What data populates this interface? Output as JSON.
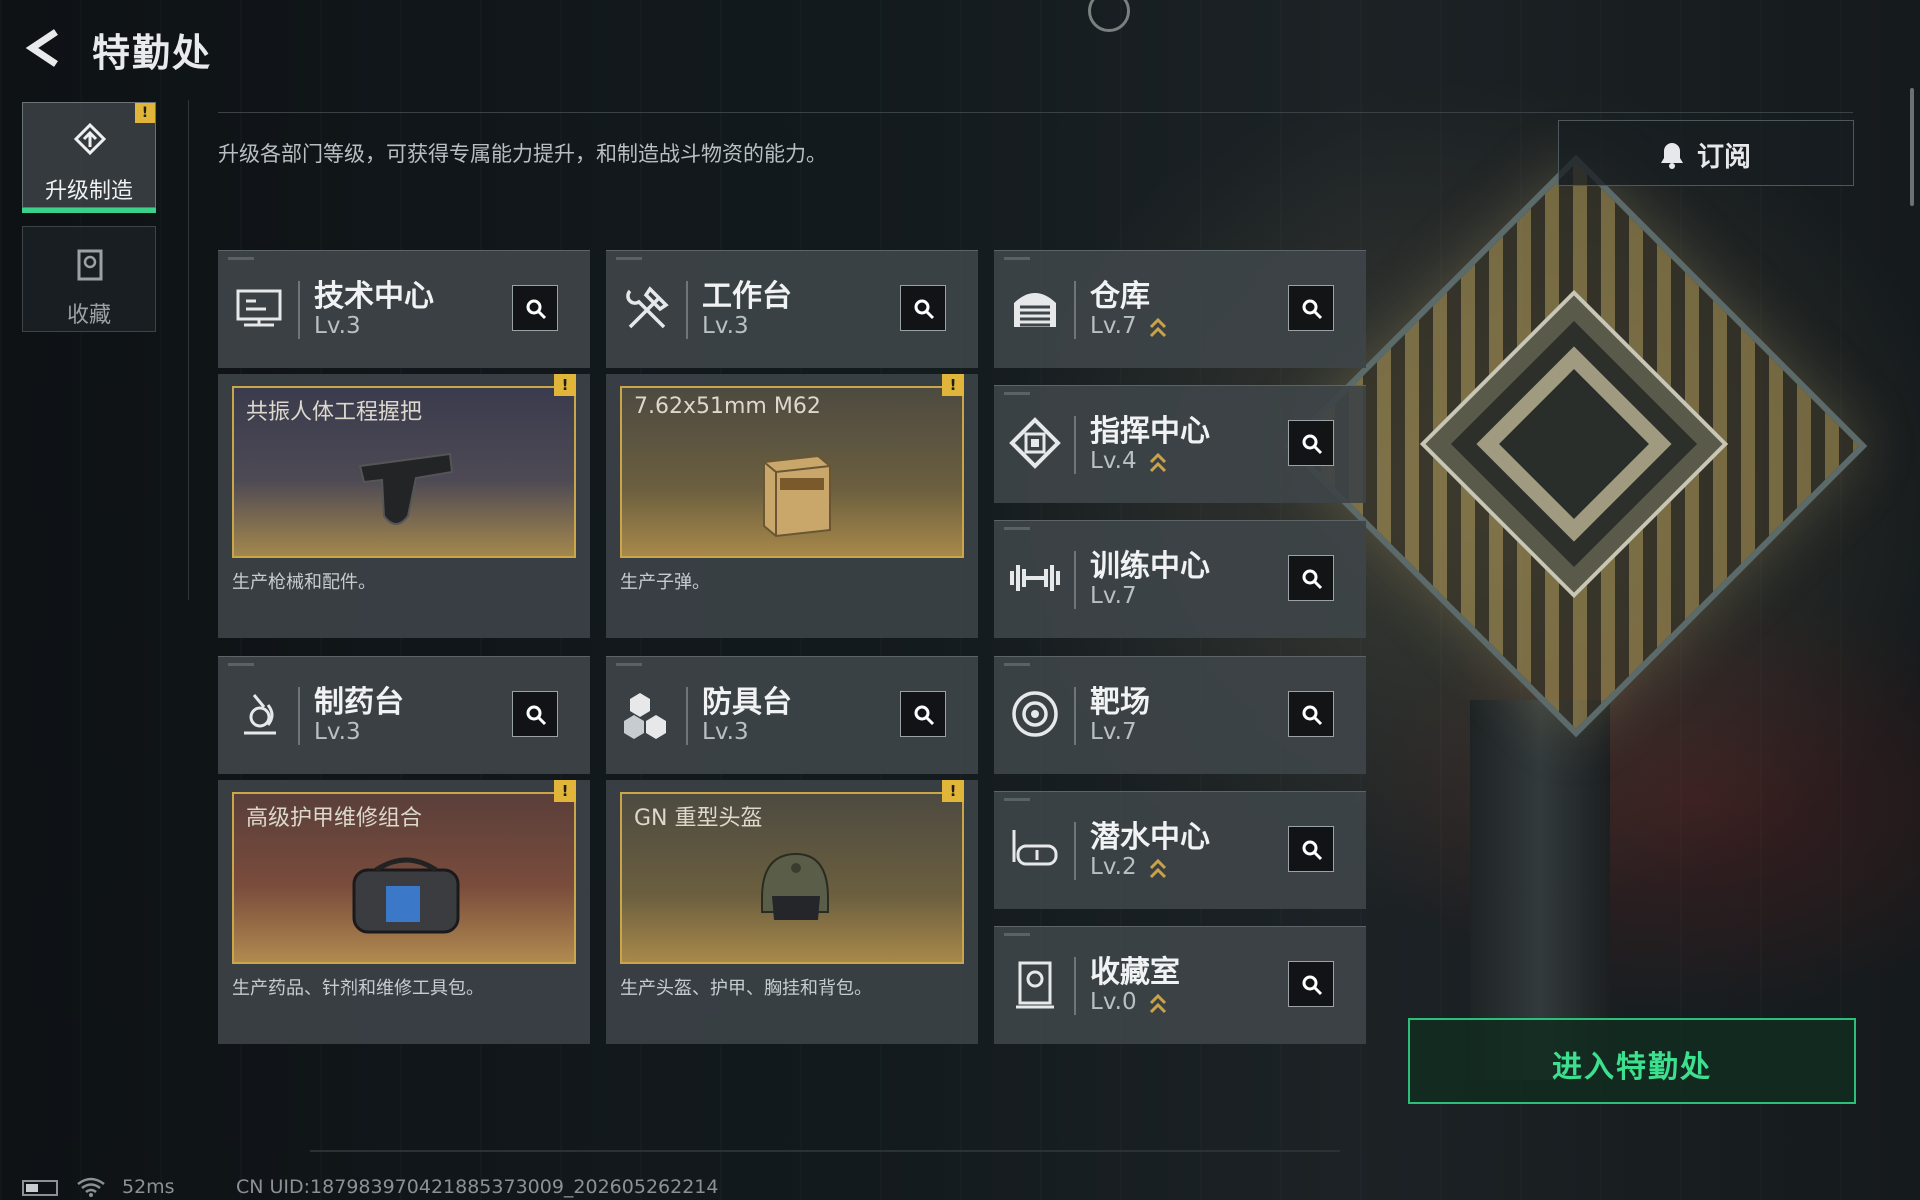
{
  "header": {
    "title": "特勤处"
  },
  "sidebar": {
    "tabs": [
      {
        "label": "升级制造",
        "badge": "!"
      },
      {
        "label": "收藏"
      }
    ]
  },
  "subtitle": "升级各部门等级，可获得专属能力提升，和制造战斗物资的能力。",
  "subscribe_label": "订阅",
  "departments": [
    {
      "name": "技术中心",
      "level": "Lv.3",
      "icon": "tech-center-icon"
    },
    {
      "name": "工作台",
      "level": "Lv.3",
      "icon": "hammer-wrench-icon"
    },
    {
      "name": "仓库",
      "level": "Lv.7",
      "icon": "warehouse-icon",
      "upgrade": true
    },
    {
      "name": "指挥中心",
      "level": "Lv.4",
      "icon": "command-center-icon",
      "upgrade": true
    },
    {
      "name": "训练中心",
      "level": "Lv.7",
      "icon": "dumbbell-icon"
    },
    {
      "name": "制药台",
      "level": "Lv.3",
      "icon": "microscope-icon"
    },
    {
      "name": "防具台",
      "level": "Lv.3",
      "icon": "armor-blocks-icon"
    },
    {
      "name": "靶场",
      "level": "Lv.7",
      "icon": "target-icon"
    },
    {
      "name": "潜水中心",
      "level": "Lv.2",
      "icon": "diving-mask-icon",
      "upgrade": true
    },
    {
      "name": "收藏室",
      "level": "Lv.0",
      "icon": "collection-room-icon",
      "upgrade": true
    }
  ],
  "production": [
    {
      "item": "共振人体工程握把",
      "desc": "生产枪械和配件。",
      "badge": "!"
    },
    {
      "item": "7.62x51mm M62",
      "desc": "生产子弹。",
      "badge": "!"
    },
    {
      "item": "高级护甲维修组合",
      "desc": "生产药品、针剂和维修工具包。",
      "badge": "!"
    },
    {
      "item": "GN 重型头盔",
      "desc": "生产头盔、护甲、胸挂和背包。",
      "badge": "!"
    }
  ],
  "enter_button": "进入特勤处",
  "status": {
    "ping": "52ms",
    "uid": "CN UID:1879839704218853730​09_202605262214"
  },
  "colors": {
    "accent": "#3ad18a",
    "gold": "#caa64b",
    "badge": "#e0b53a"
  }
}
